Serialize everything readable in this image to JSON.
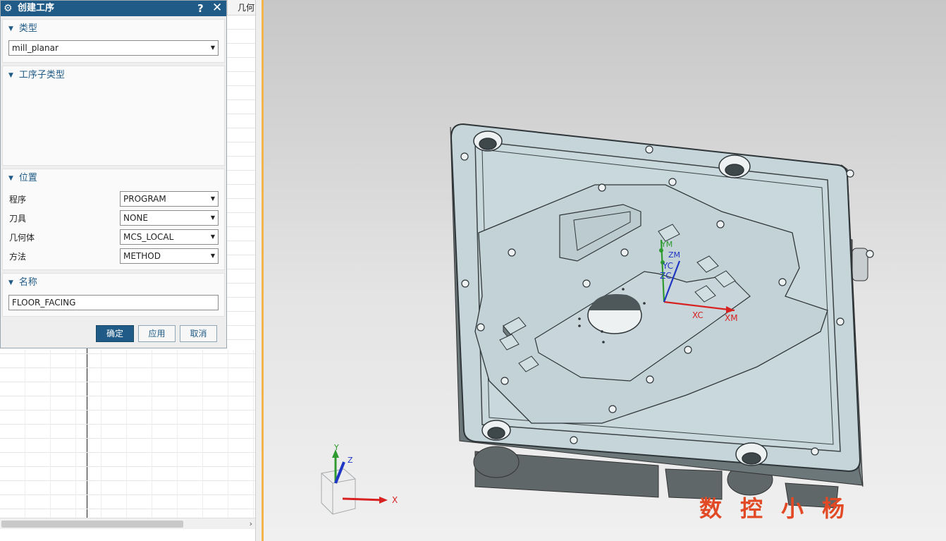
{
  "dialog": {
    "title": "创建工序",
    "help_label": "?",
    "close_label": "✕",
    "sections": {
      "type": {
        "header": "类型",
        "value": "mill_planar"
      },
      "subtype": {
        "header": "工序子类型"
      },
      "location": {
        "header": "位置",
        "fields": [
          {
            "label": "程序",
            "value": "PROGRAM"
          },
          {
            "label": "刀具",
            "value": "NONE"
          },
          {
            "label": "几何体",
            "value": "MCS_LOCAL"
          },
          {
            "label": "方法",
            "value": "METHOD"
          }
        ]
      },
      "name": {
        "header": "名称",
        "value": "FLOOR_FACING"
      }
    },
    "buttons": {
      "ok": "确定",
      "apply": "应用",
      "cancel": "取消"
    },
    "subtype_icons": [
      "floor-wall-icon",
      "floor-wall-ipw-icon",
      "face-milling-icon",
      "face-milling-zigzag-icon",
      "face-milling-area-icon",
      "face-milling-manual-icon",
      "planar-profile-wall-icon",
      "planar-mill-icon",
      "floor-facing-icon",
      "groove-milling-icon",
      "hole-milling-icon",
      "thread-milling-icon",
      "planar-text-icon",
      "planar-engrave-icon",
      "clean-up-corners-icon",
      "finish-walls-icon",
      "finish-floor-icon"
    ]
  },
  "navigator": {
    "column_header": "几何"
  },
  "viewport": {
    "axis_labels": {
      "x": "X",
      "y": "Y",
      "z": "Z"
    },
    "mcs_labels": {
      "xc": "XC",
      "yc": "YC",
      "zc": "ZC",
      "xm": "XM",
      "ym": "YM",
      "zm": "ZM"
    },
    "watermark": "数控小杨"
  },
  "colors": {
    "title_bar": "#1f5b86",
    "accent": "#1f5b86",
    "highlight_box": "#e53935",
    "part_face": "#c5d5da",
    "watermark": "#e24a25"
  }
}
